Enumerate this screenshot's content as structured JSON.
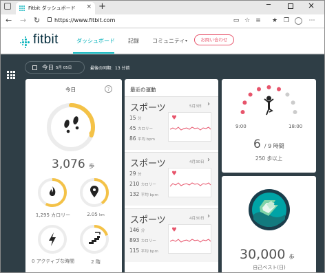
{
  "browser": {
    "tab_title": "Fitbit ダッシュボード",
    "tab_close": "×",
    "new_tab": "+",
    "url": "https://www.fitbit.com",
    "back": "←",
    "forward": "→",
    "reload": "↻",
    "win_min": "─",
    "win_close": "×"
  },
  "header": {
    "logo": "fitbit",
    "nav": [
      "ダッシュボード",
      "記録",
      "コミュニティ"
    ],
    "nav_caret": "▾",
    "contact": "お問い合わせ"
  },
  "dashboard": {
    "date_main": "今日",
    "date_sub": "5月 05日",
    "sync": "最後の同期：13 分前"
  },
  "today": {
    "title": "今日",
    "help": "?",
    "steps_value": "3,076",
    "steps_unit": "歩",
    "steps_progress": 0.31,
    "calories": "1,295 カロリー",
    "calories_progress": 0.58,
    "distance": "2.05",
    "distance_unit": "km",
    "distance_progress": 0.4,
    "active": "0 アクティブな時間",
    "active_progress": 0,
    "floors": "2 階",
    "floors_progress": 0.2,
    "accent_color": "#f4c247"
  },
  "exercise": {
    "title": "最近の運動",
    "items": [
      {
        "name": "スポーツ",
        "date": "5月3日",
        "minutes": "15",
        "minutes_unit": "分",
        "calories": "45",
        "calories_unit": "カロリー",
        "bpm": "86",
        "bpm_unit": "平均 bpm"
      },
      {
        "name": "スポーツ",
        "date": "4月30日",
        "minutes": "29",
        "minutes_unit": "分",
        "calories": "210",
        "calories_unit": "カロリー",
        "bpm": "132",
        "bpm_unit": "平均 bpm"
      },
      {
        "name": "スポーツ",
        "date": "4月30日",
        "minutes": "146",
        "minutes_unit": "分",
        "calories": "893",
        "calories_unit": "カロリー",
        "bpm": "115",
        "bpm_unit": "平均 bpm"
      }
    ],
    "chevron": "›"
  },
  "hourly": {
    "start": "9:00",
    "end": "18:00",
    "achieved": "6",
    "total": "/ 9 時間",
    "subtitle": "250 歩以上",
    "done_hours": 6,
    "total_hours": 9,
    "active_color": "#e7546b",
    "inactive_color": "#cccccc"
  },
  "best": {
    "value": "30,000",
    "unit": "歩",
    "label": "自己ベスト(日)"
  }
}
